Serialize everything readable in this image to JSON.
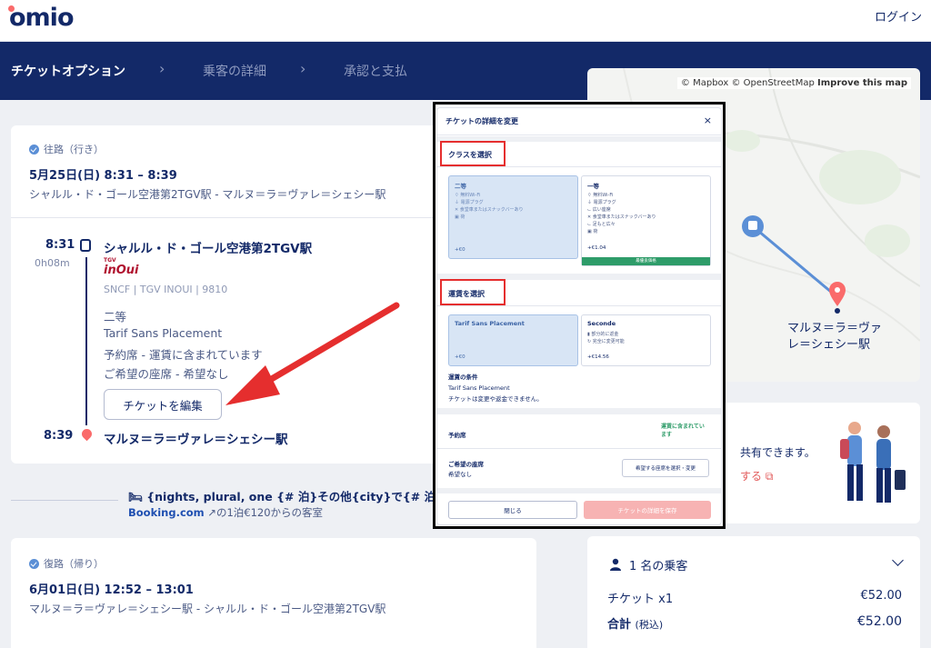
{
  "header": {
    "logo_text": "omio",
    "login_label": "ログイン"
  },
  "stepper": {
    "steps": [
      "チケットオプション",
      "乗客の詳細",
      "承認と支払"
    ]
  },
  "outbound": {
    "direction_label": "往路（行き）",
    "date_time": "5月25日(日)  8:31 – 8:39",
    "route": "シャルル・ド・ゴール空港第2TGV駅 - マルヌ＝ラ＝ヴァレ＝シェシー駅",
    "dep_time": "8:31",
    "duration": "0h08m",
    "dep_station": "シャルル・ド・ゴール空港第2TGV駅",
    "operator_logo_top": "TGV",
    "operator_logo": "inOui",
    "operator_info": "SNCF | TGV INOUI | 9810",
    "class": "二等",
    "fare": "Tarif Sans Placement",
    "reservation": "予約席 - 運賃に含まれています",
    "seat_pref": "ご希望の座席 - 希望なし",
    "edit_button": "チケットを編集",
    "arr_time": "8:39",
    "arr_station": "マルヌ＝ラ＝ヴァレ＝シェシー駅"
  },
  "booking_promo": {
    "title": "{nights, plural, one {# 泊}その他{city}で{# 泊}}",
    "brand": "Booking.com",
    "sub": "の1泊€120からの客室"
  },
  "return": {
    "direction_label": "復路（帰り）",
    "date_time": "6月01日(日)  12:52 – 13:01",
    "route": "マルヌ＝ラ＝ヴァレ＝シェシー駅 - シャルル・ド・ゴール空港第2TGV駅"
  },
  "map": {
    "attribution": "© Mapbox © OpenStreetMap",
    "improve": "Improve this map",
    "label_line1": "マルヌ＝ラ＝ヴァ",
    "label_line2": "レ＝シェシー駅"
  },
  "share_card": {
    "text": "共有できます。",
    "link": "する"
  },
  "passengers": {
    "count_label": "1 名の乗客",
    "ticket_label": "チケット x1",
    "ticket_price": "€52.00",
    "total_label": "合計",
    "total_note": "(税込)",
    "total_price": "€52.00"
  },
  "modal": {
    "title": "チケットの詳細を変更",
    "close_icon": "×",
    "class_section": "クラスを選択",
    "class_options": [
      {
        "title": "二等",
        "features": [
          "無料Wi-Fi",
          "電源プラグ",
          "食堂車またはスナックバーあり",
          "荷"
        ],
        "price": "+€0",
        "selected": true
      },
      {
        "title": "一等",
        "features": [
          "無料Wi-Fi",
          "電源プラグ",
          "広い座席",
          "食堂車またはスナックバーあり",
          "足もと広々",
          "荷"
        ],
        "price": "+€1.04",
        "badge": "最優良価格",
        "selected": false
      }
    ],
    "fare_section": "運賃を選択",
    "fare_options": [
      {
        "title": "Tarif Sans Placement",
        "features": [],
        "price": "+€0",
        "selected": true
      },
      {
        "title": "Seconde",
        "features": [
          "部分的に返金",
          "完全に変更可能"
        ],
        "price": "+€14.56",
        "selected": false
      }
    ],
    "conditions_title": "運賃の条件",
    "conditions_fare": "Tarif Sans Placement",
    "conditions_text": "チケットは変更や返金できません。",
    "reservation_label": "予約席",
    "reservation_value_1": "運賃に含まれてい",
    "reservation_value_2": "ます",
    "seat_label": "ご希望の座席",
    "seat_value": "希望なし",
    "seat_button": "希望する座席を選択・変更",
    "close_button": "閉じる",
    "save_button": "チケットの詳細を保存"
  },
  "colors": {
    "brand_navy": "#132968",
    "accent_red": "#fa6b6b",
    "annotation_red": "#e52e2e",
    "green": "#2e9c69"
  }
}
